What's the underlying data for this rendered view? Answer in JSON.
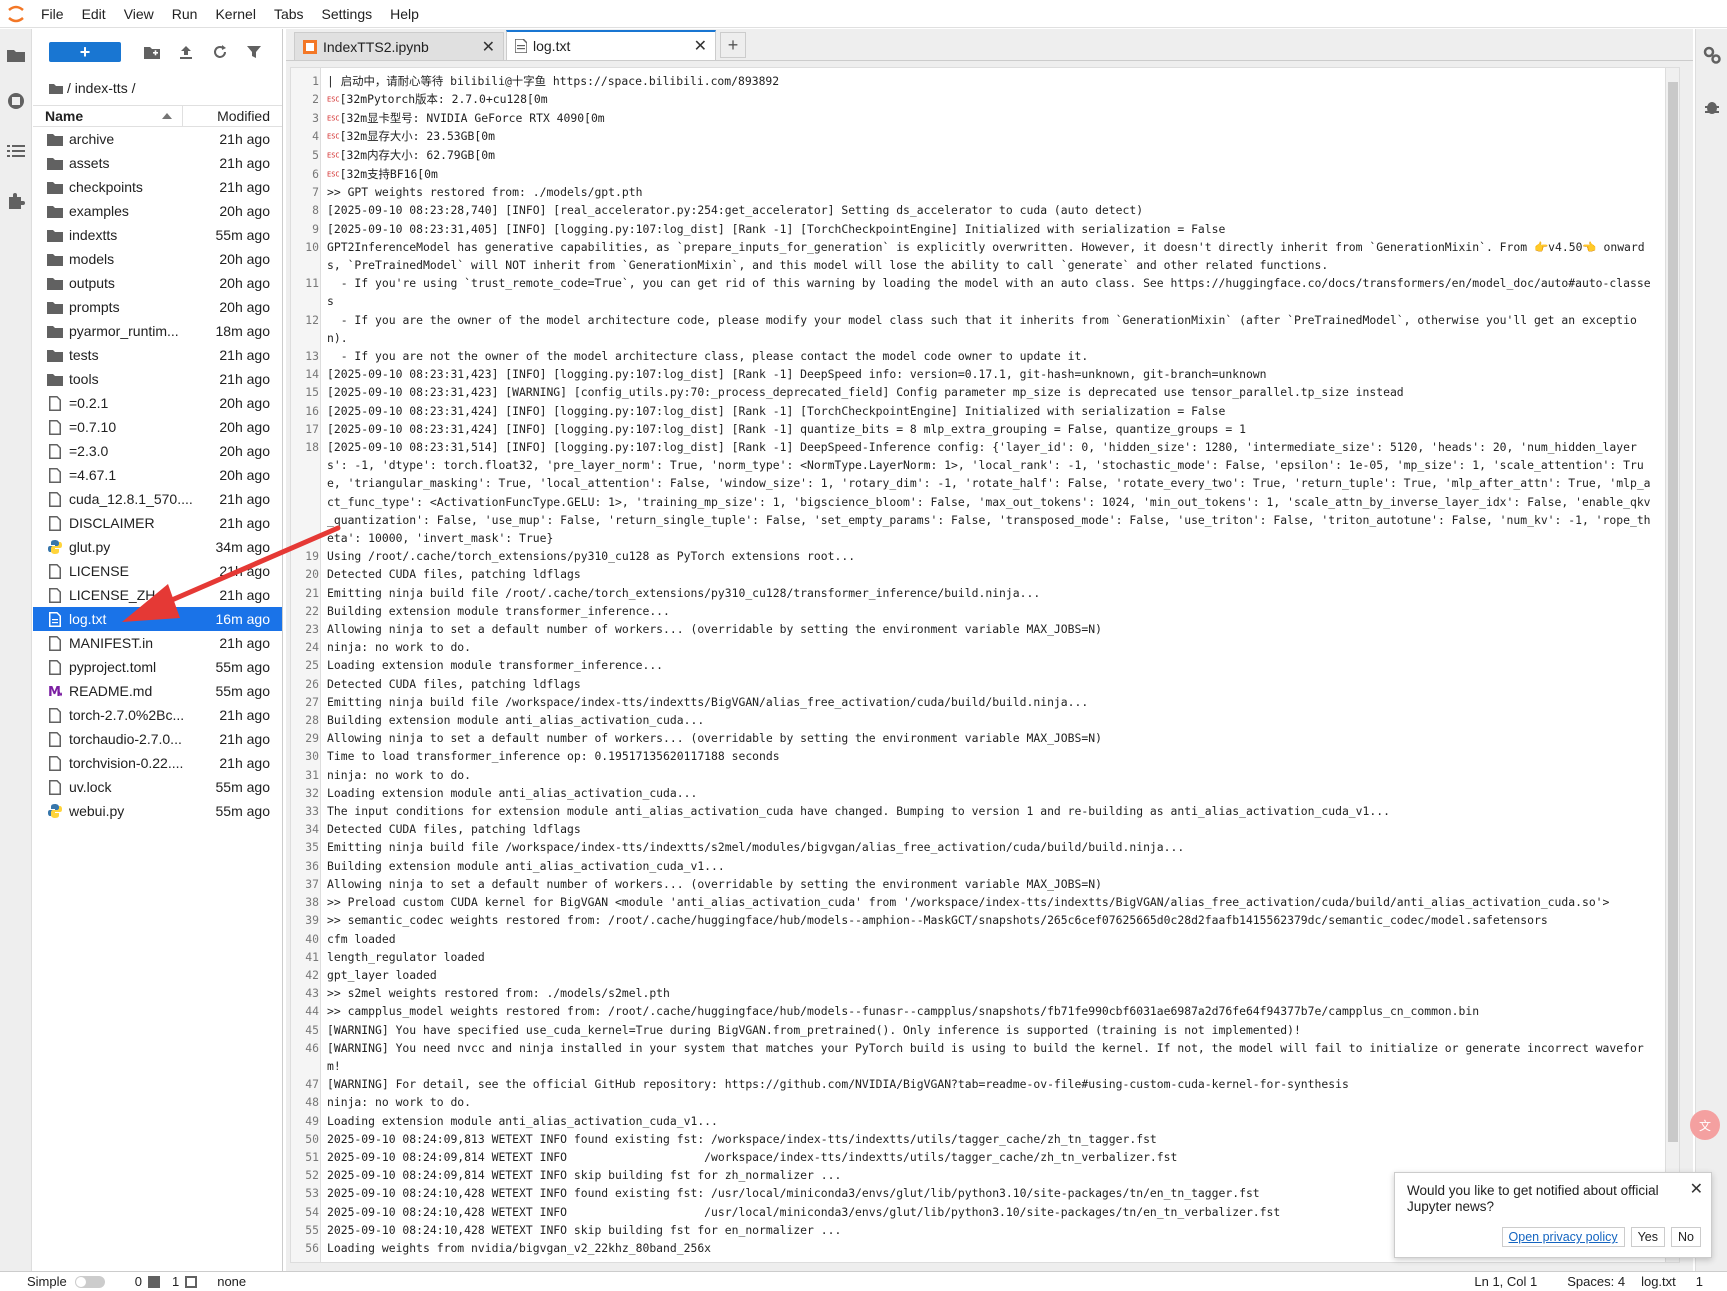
{
  "menubar": {
    "items": [
      "File",
      "Edit",
      "View",
      "Run",
      "Kernel",
      "Tabs",
      "Settings",
      "Help"
    ]
  },
  "filebrowser": {
    "new_label": "+",
    "breadcrumb": "/ index-tts /",
    "col_name": "Name",
    "col_modified": "Modified",
    "files": [
      {
        "name": "archive",
        "modified": "21h ago",
        "icon": "folder-icon"
      },
      {
        "name": "assets",
        "modified": "21h ago",
        "icon": "folder-icon"
      },
      {
        "name": "checkpoints",
        "modified": "21h ago",
        "icon": "folder-icon"
      },
      {
        "name": "examples",
        "modified": "20h ago",
        "icon": "folder-icon"
      },
      {
        "name": "indextts",
        "modified": "55m ago",
        "icon": "folder-icon"
      },
      {
        "name": "models",
        "modified": "20h ago",
        "icon": "folder-icon"
      },
      {
        "name": "outputs",
        "modified": "20h ago",
        "icon": "folder-icon"
      },
      {
        "name": "prompts",
        "modified": "20h ago",
        "icon": "folder-icon"
      },
      {
        "name": "pyarmor_runtim...",
        "modified": "18m ago",
        "icon": "folder-icon"
      },
      {
        "name": "tests",
        "modified": "21h ago",
        "icon": "folder-icon"
      },
      {
        "name": "tools",
        "modified": "21h ago",
        "icon": "folder-icon"
      },
      {
        "name": "=0.2.1",
        "modified": "20h ago",
        "icon": "file-icon"
      },
      {
        "name": "=0.7.10",
        "modified": "20h ago",
        "icon": "file-icon"
      },
      {
        "name": "=2.3.0",
        "modified": "20h ago",
        "icon": "file-icon"
      },
      {
        "name": "=4.67.1",
        "modified": "20h ago",
        "icon": "file-icon"
      },
      {
        "name": "cuda_12.8.1_570....",
        "modified": "21h ago",
        "icon": "file-icon"
      },
      {
        "name": "DISCLAIMER",
        "modified": "21h ago",
        "icon": "file-icon"
      },
      {
        "name": "glut.py",
        "modified": "34m ago",
        "icon": "python-icon"
      },
      {
        "name": "LICENSE",
        "modified": "21h ago",
        "icon": "file-icon"
      },
      {
        "name": "LICENSE_ZH...",
        "modified": "21h ago",
        "icon": "file-icon"
      },
      {
        "name": "log.txt",
        "modified": "16m ago",
        "icon": "text-file-icon",
        "selected": true
      },
      {
        "name": "MANIFEST.in",
        "modified": "21h ago",
        "icon": "file-icon"
      },
      {
        "name": "pyproject.toml",
        "modified": "55m ago",
        "icon": "file-icon"
      },
      {
        "name": "README.md",
        "modified": "55m ago",
        "icon": "markdown-icon"
      },
      {
        "name": "torch-2.7.0%2Bc...",
        "modified": "21h ago",
        "icon": "file-icon"
      },
      {
        "name": "torchaudio-2.7.0...",
        "modified": "21h ago",
        "icon": "file-icon"
      },
      {
        "name": "torchvision-0.22....",
        "modified": "21h ago",
        "icon": "file-icon"
      },
      {
        "name": "uv.lock",
        "modified": "55m ago",
        "icon": "file-icon"
      },
      {
        "name": "webui.py",
        "modified": "55m ago",
        "icon": "python-icon"
      }
    ]
  },
  "tabs": [
    {
      "label": "IndexTTS2.ipynb",
      "icon": "notebook-icon",
      "active": false
    },
    {
      "label": "log.txt",
      "icon": "text-file-icon",
      "active": true
    }
  ],
  "editor": {
    "lines": [
      {
        "n": "1",
        "t": "| 启动中，请耐心等待 bilibili@十字鱼 https://space.bilibili.com/893892"
      },
      {
        "n": "2",
        "t": "[32mPytorch版本: 2.7.0+cu128[0m",
        "esc": true
      },
      {
        "n": "3",
        "t": "[32m显卡型号: NVIDIA GeForce RTX 4090[0m",
        "esc": true
      },
      {
        "n": "4",
        "t": "[32m显存大小: 23.53GB[0m",
        "esc": true
      },
      {
        "n": "5",
        "t": "[32m内存大小: 62.79GB[0m",
        "esc": true
      },
      {
        "n": "6",
        "t": "[32m支持BF16[0m",
        "esc": true
      },
      {
        "n": "7",
        "t": ">> GPT weights restored from: ./models/gpt.pth"
      },
      {
        "n": "8",
        "t": "[2025-09-10 08:23:28,740] [INFO] [real_accelerator.py:254:get_accelerator] Setting ds_accelerator to cuda (auto detect)"
      },
      {
        "n": "9",
        "t": "[2025-09-10 08:23:31,405] [INFO] [logging.py:107:log_dist] [Rank -1] [TorchCheckpointEngine] Initialized with serialization = False"
      },
      {
        "n": "10",
        "t": "GPT2InferenceModel has generative capabilities, as `prepare_inputs_for_generation` is explicitly overwritten. However, it doesn't directly inherit from `GenerationMixin`. From 👉v4.50👈 onwards, `PreTrainedModel` will NOT inherit from `GenerationMixin`, and this model will lose the ability to call `generate` and other related functions."
      },
      {
        "n": "11",
        "t": "  - If you're using `trust_remote_code=True`, you can get rid of this warning by loading the model with an auto class. See https://huggingface.co/docs/transformers/en/model_doc/auto#auto-classes"
      },
      {
        "n": "12",
        "t": "  - If you are the owner of the model architecture code, please modify your model class such that it inherits from `GenerationMixin` (after `PreTrainedModel`, otherwise you'll get an exception)."
      },
      {
        "n": "13",
        "t": "  - If you are not the owner of the model architecture class, please contact the model code owner to update it."
      },
      {
        "n": "14",
        "t": "[2025-09-10 08:23:31,423] [INFO] [logging.py:107:log_dist] [Rank -1] DeepSpeed info: version=0.17.1, git-hash=unknown, git-branch=unknown"
      },
      {
        "n": "15",
        "t": "[2025-09-10 08:23:31,423] [WARNING] [config_utils.py:70:_process_deprecated_field] Config parameter mp_size is deprecated use tensor_parallel.tp_size instead"
      },
      {
        "n": "16",
        "t": "[2025-09-10 08:23:31,424] [INFO] [logging.py:107:log_dist] [Rank -1] [TorchCheckpointEngine] Initialized with serialization = False"
      },
      {
        "n": "17",
        "t": "[2025-09-10 08:23:31,424] [INFO] [logging.py:107:log_dist] [Rank -1] quantize_bits = 8 mlp_extra_grouping = False, quantize_groups = 1"
      },
      {
        "n": "18",
        "t": "[2025-09-10 08:23:31,514] [INFO] [logging.py:107:log_dist] [Rank -1] DeepSpeed-Inference config: {'layer_id': 0, 'hidden_size': 1280, 'intermediate_size': 5120, 'heads': 20, 'num_hidden_layers': -1, 'dtype': torch.float32, 'pre_layer_norm': True, 'norm_type': <NormType.LayerNorm: 1>, 'local_rank': -1, 'stochastic_mode': False, 'epsilon': 1e-05, 'mp_size': 1, 'scale_attention': True, 'triangular_masking': True, 'local_attention': False, 'window_size': 1, 'rotary_dim': -1, 'rotate_half': False, 'rotate_every_two': True, 'return_tuple': True, 'mlp_after_attn': True, 'mlp_act_func_type': <ActivationFuncType.GELU: 1>, 'training_mp_size': 1, 'bigscience_bloom': False, 'max_out_tokens': 1024, 'min_out_tokens': 1, 'scale_attn_by_inverse_layer_idx': False, 'enable_qkv_quantization': False, 'use_mup': False, 'return_single_tuple': False, 'set_empty_params': False, 'transposed_mode': False, 'use_triton': False, 'triton_autotune': False, 'num_kv': -1, 'rope_theta': 10000, 'invert_mask': True}"
      },
      {
        "n": "19",
        "t": "Using /root/.cache/torch_extensions/py310_cu128 as PyTorch extensions root..."
      },
      {
        "n": "20",
        "t": "Detected CUDA files, patching ldflags"
      },
      {
        "n": "21",
        "t": "Emitting ninja build file /root/.cache/torch_extensions/py310_cu128/transformer_inference/build.ninja..."
      },
      {
        "n": "22",
        "t": "Building extension module transformer_inference..."
      },
      {
        "n": "23",
        "t": "Allowing ninja to set a default number of workers... (overridable by setting the environment variable MAX_JOBS=N)"
      },
      {
        "n": "24",
        "t": "ninja: no work to do."
      },
      {
        "n": "25",
        "t": "Loading extension module transformer_inference..."
      },
      {
        "n": "26",
        "t": "Detected CUDA files, patching ldflags"
      },
      {
        "n": "27",
        "t": "Emitting ninja build file /workspace/index-tts/indextts/BigVGAN/alias_free_activation/cuda/build/build.ninja..."
      },
      {
        "n": "28",
        "t": "Building extension module anti_alias_activation_cuda..."
      },
      {
        "n": "29",
        "t": "Allowing ninja to set a default number of workers... (overridable by setting the environment variable MAX_JOBS=N)"
      },
      {
        "n": "30",
        "t": "Time to load transformer_inference op: 0.19517135620117188 seconds"
      },
      {
        "n": "31",
        "t": "ninja: no work to do."
      },
      {
        "n": "32",
        "t": "Loading extension module anti_alias_activation_cuda..."
      },
      {
        "n": "33",
        "t": "The input conditions for extension module anti_alias_activation_cuda have changed. Bumping to version 1 and re-building as anti_alias_activation_cuda_v1..."
      },
      {
        "n": "34",
        "t": "Detected CUDA files, patching ldflags"
      },
      {
        "n": "35",
        "t": "Emitting ninja build file /workspace/index-tts/indextts/s2mel/modules/bigvgan/alias_free_activation/cuda/build/build.ninja..."
      },
      {
        "n": "36",
        "t": "Building extension module anti_alias_activation_cuda_v1..."
      },
      {
        "n": "37",
        "t": "Allowing ninja to set a default number of workers... (overridable by setting the environment variable MAX_JOBS=N)"
      },
      {
        "n": "38",
        "t": ">> Preload custom CUDA kernel for BigVGAN <module 'anti_alias_activation_cuda' from '/workspace/index-tts/indextts/BigVGAN/alias_free_activation/cuda/build/anti_alias_activation_cuda.so'>"
      },
      {
        "n": "39",
        "t": ">> semantic_codec weights restored from: /root/.cache/huggingface/hub/models--amphion--MaskGCT/snapshots/265c6cef07625665d0c28d2faafb1415562379dc/semantic_codec/model.safetensors"
      },
      {
        "n": "40",
        "t": "cfm loaded"
      },
      {
        "n": "41",
        "t": "length_regulator loaded"
      },
      {
        "n": "42",
        "t": "gpt_layer loaded"
      },
      {
        "n": "43",
        "t": ">> s2mel weights restored from: ./models/s2mel.pth"
      },
      {
        "n": "44",
        "t": ">> campplus_model weights restored from: /root/.cache/huggingface/hub/models--funasr--campplus/snapshots/fb71fe990cbf6031ae6987a2d76fe64f94377b7e/campplus_cn_common.bin"
      },
      {
        "n": "45",
        "t": "[WARNING] You have specified use_cuda_kernel=True during BigVGAN.from_pretrained(). Only inference is supported (training is not implemented)!"
      },
      {
        "n": "46",
        "t": "[WARNING] You need nvcc and ninja installed in your system that matches your PyTorch build is using to build the kernel. If not, the model will fail to initialize or generate incorrect waveform!"
      },
      {
        "n": "47",
        "t": "[WARNING] For detail, see the official GitHub repository: https://github.com/NVIDIA/BigVGAN?tab=readme-ov-file#using-custom-cuda-kernel-for-synthesis"
      },
      {
        "n": "48",
        "t": "ninja: no work to do."
      },
      {
        "n": "49",
        "t": "Loading extension module anti_alias_activation_cuda_v1..."
      },
      {
        "n": "50",
        "t": "2025-09-10 08:24:09,813 WETEXT INFO found existing fst: /workspace/index-tts/indextts/utils/tagger_cache/zh_tn_tagger.fst"
      },
      {
        "n": "51",
        "t": "2025-09-10 08:24:09,814 WETEXT INFO                    /workspace/index-tts/indextts/utils/tagger_cache/zh_tn_verbalizer.fst"
      },
      {
        "n": "52",
        "t": "2025-09-10 08:24:09,814 WETEXT INFO skip building fst for zh_normalizer ..."
      },
      {
        "n": "53",
        "t": "2025-09-10 08:24:10,428 WETEXT INFO found existing fst: /usr/local/miniconda3/envs/glut/lib/python3.10/site-packages/tn/en_tn_tagger.fst"
      },
      {
        "n": "54",
        "t": "2025-09-10 08:24:10,428 WETEXT INFO                    /usr/local/miniconda3/envs/glut/lib/python3.10/site-packages/tn/en_tn_verbalizer.fst"
      },
      {
        "n": "55",
        "t": "2025-09-10 08:24:10,428 WETEXT INFO skip building fst for en_normalizer ..."
      },
      {
        "n": "56",
        "t": "Loading weights from nvidia/bigvgan_v2_22khz_80band_256x"
      }
    ]
  },
  "notification": {
    "message": "Would you like to get notified about official Jupyter news?",
    "privacy_link": "Open privacy policy",
    "yes": "Yes",
    "no": "No"
  },
  "statusbar": {
    "mode": "Simple",
    "terminals": "0",
    "kernels": "1",
    "kernel_status": "none",
    "cursor": "Ln 1, Col 1",
    "spaces": "Spaces: 4",
    "file": "log.txt",
    "count": "1"
  },
  "colors": {
    "accent": "#1976d2",
    "selected_row": "#1a73e8",
    "annotation_arrow": "#e53935"
  }
}
